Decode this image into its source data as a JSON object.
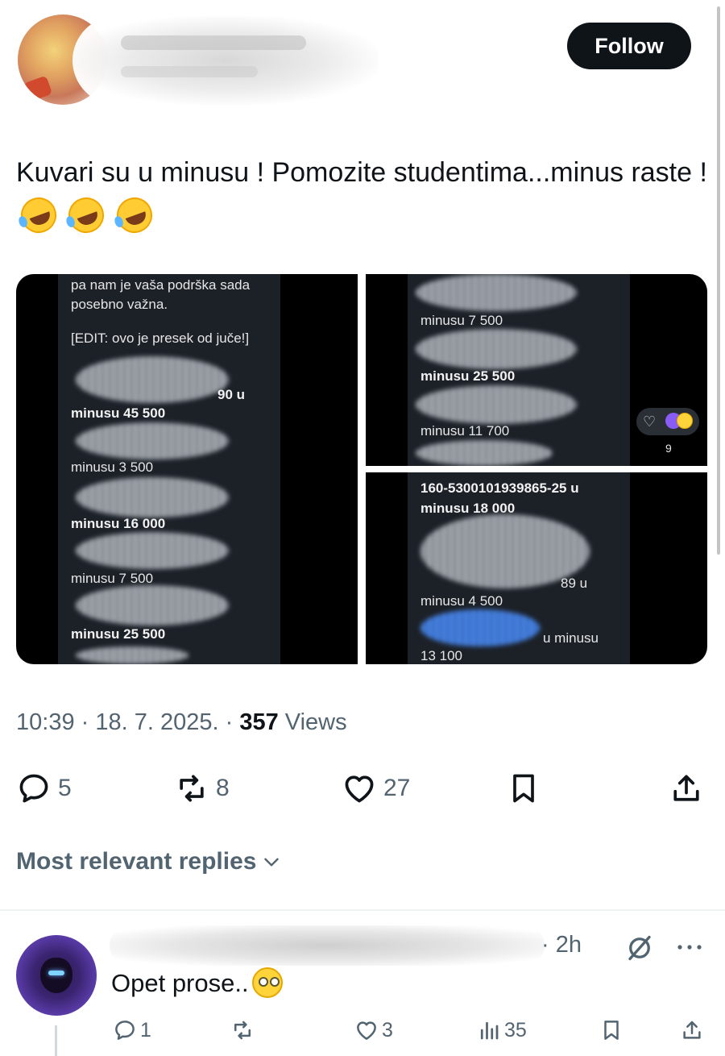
{
  "author": {
    "follow_label": "Follow"
  },
  "tweet": {
    "text": "Kuvari su u minusu ! Pomozite studentima...minus raste !",
    "emojis": [
      "rolling-on-floor-laughing",
      "rolling-on-floor-laughing",
      "rolling-on-floor-laughing"
    ]
  },
  "media": {
    "left_lines": [
      "pa nam je vaša podrška sada",
      "posebno važna.",
      "[EDIT: ovo je presek od juče!]",
      "90 u",
      "minusu 45 500",
      "minusu 3 500",
      "minusu 16 000",
      "minusu 7 500",
      "minusu 25 500"
    ],
    "top_right_lines": [
      "minusu 7 500",
      "minusu 25 500",
      "minusu 11 700"
    ],
    "bottom_right_lines": [
      "160-5300101939865-25 u",
      "minusu 18 000",
      "89 u",
      "minusu 4 500",
      "u minusu",
      "13 100"
    ],
    "reaction_count": "9"
  },
  "meta": {
    "time": "10:39 · 18. 7. 2025. · ",
    "views_count": "357",
    "views_label": " Views"
  },
  "actions": {
    "replies": "5",
    "reposts": "8",
    "likes": "27"
  },
  "replies_section": {
    "label": "Most relevant replies"
  },
  "reply": {
    "time": "· 2h",
    "text": "Opet prose..",
    "emoji": "face-with-rolling-eyes",
    "replies": "1",
    "likes": "3",
    "views": "35"
  },
  "colors": {
    "primary_text": "#0f1419",
    "secondary_text": "#536471",
    "follow_bg": "#0f1419"
  }
}
